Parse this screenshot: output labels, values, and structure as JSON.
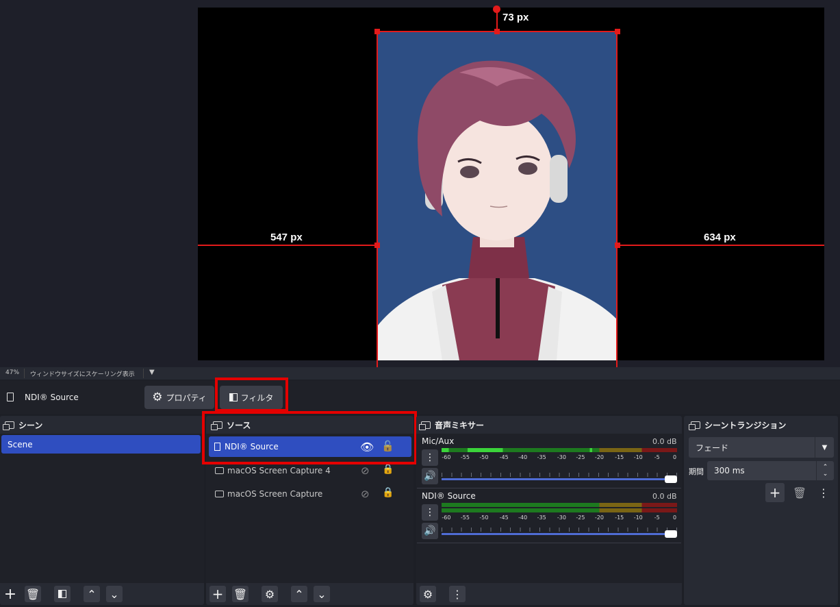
{
  "preview": {
    "dim_top": "73 px",
    "dim_left": "547 px",
    "dim_right": "634 px"
  },
  "statusbar": {
    "zoom": "47%",
    "scale_mode": "ウィンドウサイズにスケーリング表示"
  },
  "context": {
    "source_name": "NDI® Source",
    "properties_label": "プロパティ",
    "filters_label": "フィルタ"
  },
  "scenes": {
    "title": "シーン",
    "items": [
      "Scene"
    ]
  },
  "sources": {
    "title": "ソース",
    "items": [
      {
        "name": "NDI® Source",
        "visible": true,
        "locked": false,
        "selected": true
      },
      {
        "name": "macOS Screen Capture 4",
        "visible": false,
        "locked": true,
        "selected": false
      },
      {
        "name": "macOS Screen Capture",
        "visible": false,
        "locked": true,
        "selected": false
      }
    ]
  },
  "mixer": {
    "title": "音声ミキサー",
    "channels": [
      {
        "name": "Mic/Aux",
        "level": "0.0 dB",
        "volume": 1.0
      },
      {
        "name": "NDI® Source",
        "level": "0.0 dB",
        "volume": 1.0
      }
    ],
    "scale": [
      "-60",
      "-55",
      "-50",
      "-45",
      "-40",
      "-35",
      "-30",
      "-25",
      "-20",
      "-15",
      "-10",
      "-5",
      "0"
    ]
  },
  "transitions": {
    "title": "シーントランジション",
    "type": "フェード",
    "duration_label": "期間",
    "duration": "300 ms"
  },
  "colors": {
    "accent": "#2f4ec0",
    "highlight": "#e40000",
    "guide": "#e31b1b",
    "avatar_bg": "#2d4e84"
  }
}
